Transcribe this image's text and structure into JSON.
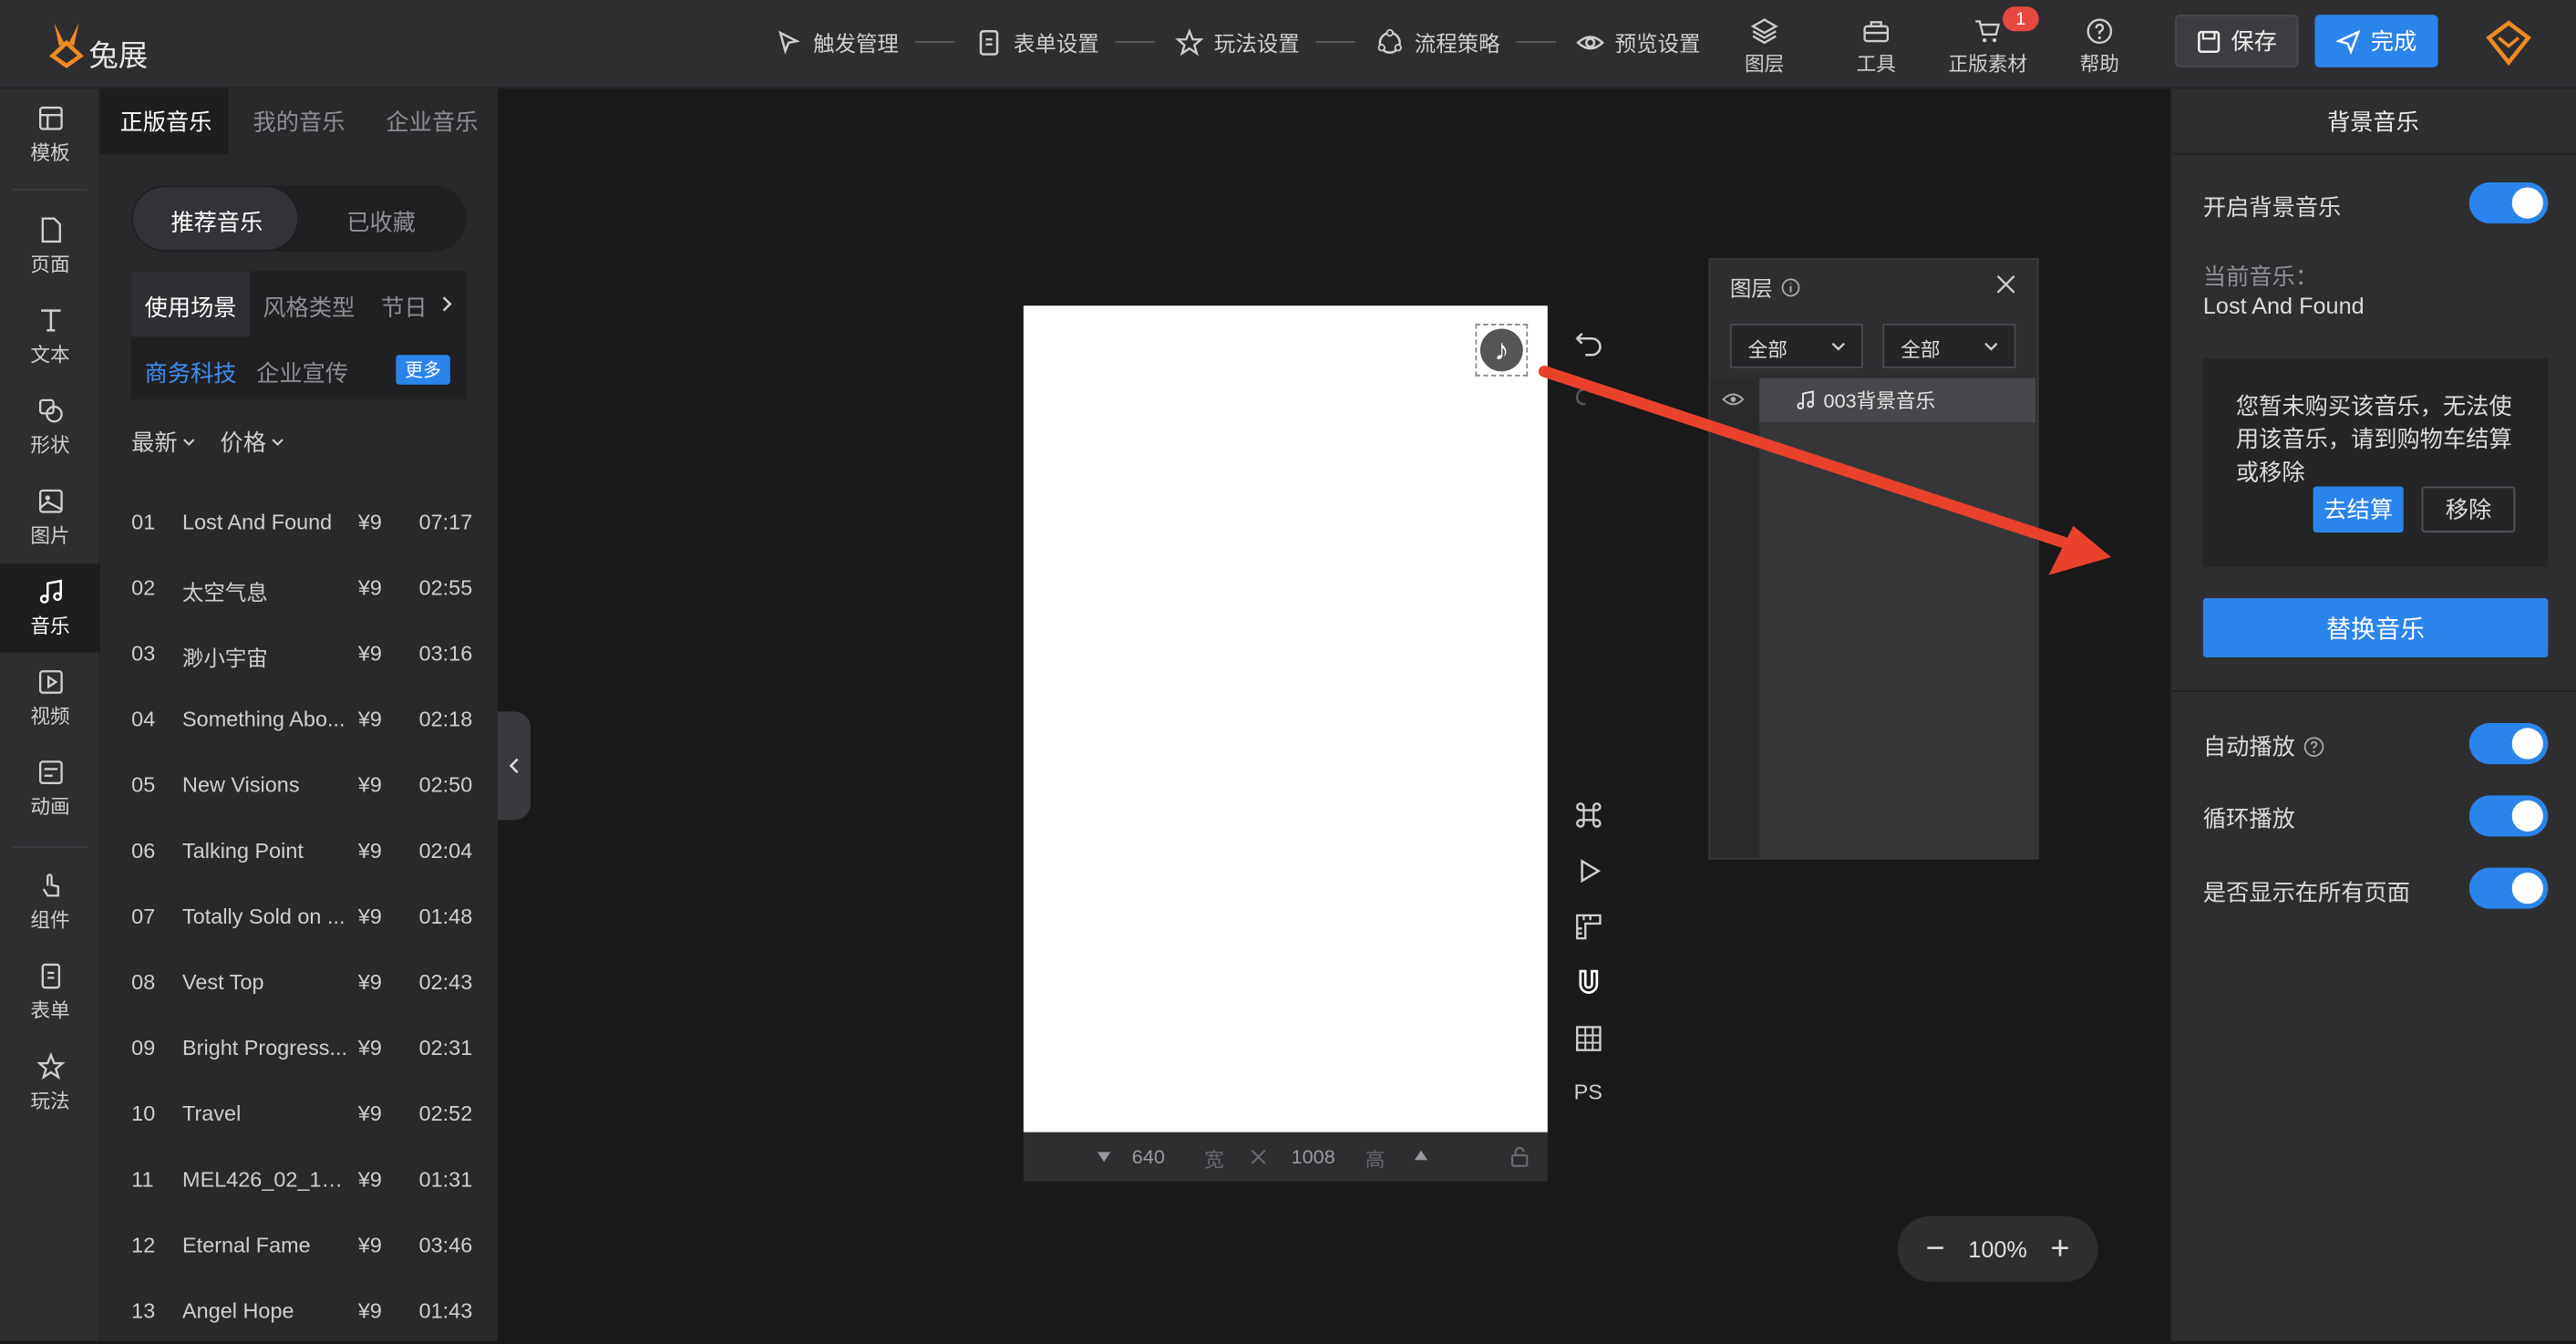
{
  "brand": {
    "name": "兔展",
    "accent": "#f08a24"
  },
  "topnav": {
    "steps": [
      {
        "label": "触发管理",
        "icon": "pointer-icon"
      },
      {
        "label": "表单设置",
        "icon": "form-icon"
      },
      {
        "label": "玩法设置",
        "icon": "star-icon"
      },
      {
        "label": "流程策略",
        "icon": "flow-icon"
      },
      {
        "label": "预览设置",
        "icon": "eye-icon"
      }
    ],
    "tools": [
      {
        "label": "图层",
        "icon": "layers-icon"
      },
      {
        "label": "工具",
        "icon": "toolbox-icon"
      },
      {
        "label": "正版素材",
        "icon": "cart-icon"
      },
      {
        "label": "帮助",
        "icon": "help-icon"
      }
    ],
    "cart_count": "1",
    "save_label": "保存",
    "done_label": "完成"
  },
  "leftnav": {
    "items": [
      {
        "label": "模板"
      },
      {
        "label": "页面"
      },
      {
        "label": "文本"
      },
      {
        "label": "形状"
      },
      {
        "label": "图片"
      },
      {
        "label": "音乐"
      },
      {
        "label": "视频"
      },
      {
        "label": "动画"
      },
      {
        "label": "组件"
      },
      {
        "label": "表单"
      },
      {
        "label": "玩法"
      }
    ],
    "active": "音乐"
  },
  "music_panel": {
    "tabs": [
      "正版音乐",
      "我的音乐",
      "企业音乐"
    ],
    "pill": [
      "推荐音乐",
      "已收藏"
    ],
    "scene_tabs": [
      "使用场景",
      "风格类型",
      "节日"
    ],
    "sub_tags": [
      "商务科技",
      "企业宣传"
    ],
    "more_label": "更多",
    "sort": [
      "最新",
      "价格"
    ],
    "tracks": [
      {
        "idx": "01",
        "name": "Lost And Found",
        "price": "¥9",
        "duration": "07:17"
      },
      {
        "idx": "02",
        "name": "太空气息",
        "price": "¥9",
        "duration": "02:55"
      },
      {
        "idx": "03",
        "name": "渺小宇宙",
        "price": "¥9",
        "duration": "03:16"
      },
      {
        "idx": "04",
        "name": "Something Abo...",
        "price": "¥9",
        "duration": "02:18"
      },
      {
        "idx": "05",
        "name": "New Visions",
        "price": "¥9",
        "duration": "02:50"
      },
      {
        "idx": "06",
        "name": "Talking Point",
        "price": "¥9",
        "duration": "02:04"
      },
      {
        "idx": "07",
        "name": "Totally Sold on ...",
        "price": "¥9",
        "duration": "01:48"
      },
      {
        "idx": "08",
        "name": "Vest Top",
        "price": "¥9",
        "duration": "02:43"
      },
      {
        "idx": "09",
        "name": "Bright Progress...",
        "price": "¥9",
        "duration": "02:31"
      },
      {
        "idx": "10",
        "name": "Travel",
        "price": "¥9",
        "duration": "02:52"
      },
      {
        "idx": "11",
        "name": "MEL426_02_1_...",
        "price": "¥9",
        "duration": "01:31"
      },
      {
        "idx": "12",
        "name": "Eternal Fame",
        "price": "¥9",
        "duration": "03:46"
      },
      {
        "idx": "13",
        "name": "Angel Hope",
        "price": "¥9",
        "duration": "01:43"
      }
    ]
  },
  "canvas": {
    "width": "640",
    "width_unit": "宽",
    "height": "1008",
    "height_unit": "高",
    "side_tools": [
      "command-icon",
      "play-icon",
      "ruler-icon",
      "magnet-icon",
      "grid-icon",
      "PS"
    ],
    "zoom": "100%"
  },
  "layer_panel": {
    "title": "图层",
    "filter1": "全部",
    "filter2": "全部",
    "layers": [
      {
        "name": "003背景音乐",
        "icon": "music-note-icon"
      }
    ]
  },
  "right_panel": {
    "title": "背景音乐",
    "enable_label": "开启背景音乐",
    "current_label": "当前音乐：",
    "current_value": "Lost And Found",
    "warning": "您暂未购买该音乐，无法使用该音乐，请到购物车结算或移除",
    "checkout_label": "去结算",
    "remove_label": "移除",
    "replace_label": "替换音乐",
    "autoplay_label": "自动播放",
    "loop_label": "循环播放",
    "show_all_label": "是否显示在所有页面",
    "toggles": {
      "enable": true,
      "autoplay": true,
      "loop": true,
      "show_all": true
    }
  },
  "annotation": {
    "arrow_color": "#e8412c"
  }
}
